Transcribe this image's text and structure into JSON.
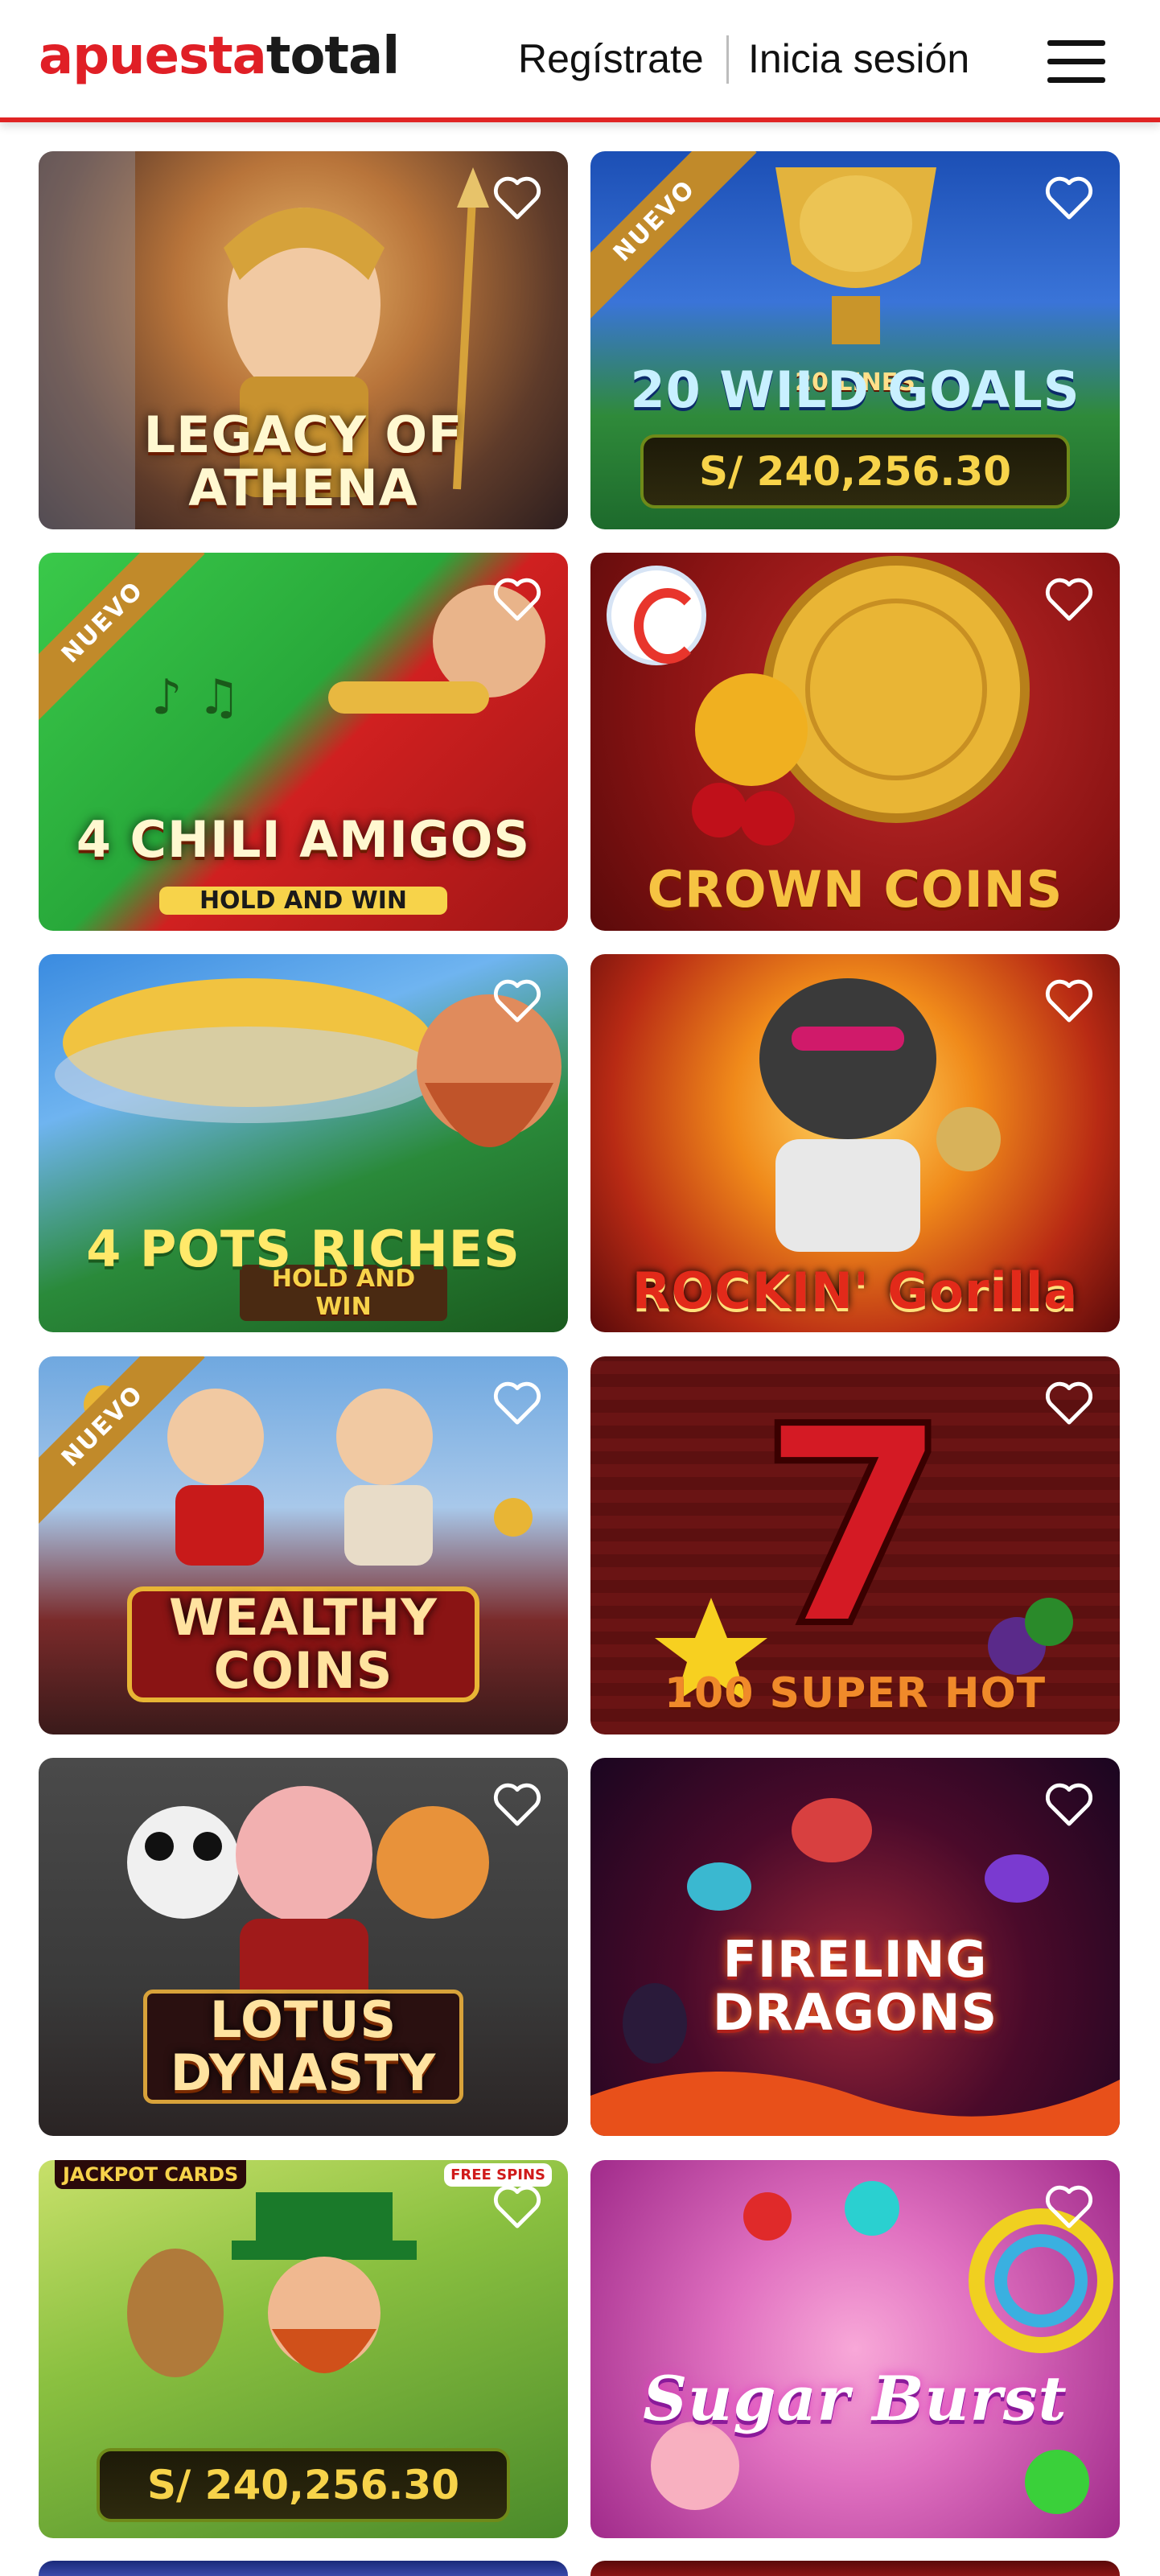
{
  "header": {
    "logo_part1": "apuesta",
    "logo_part2": "total",
    "register_label": "Regístrate",
    "login_label": "Inicia sesión",
    "menu_icon": "hamburger-icon"
  },
  "colors": {
    "brand_red": "#e01f26",
    "ribbon_gold": "#c18a2a",
    "jackpot_gold": "#f7d34a"
  },
  "ribbon_label": "NUEVO",
  "games": [
    {
      "title": "LEGACY OF ATHENA",
      "subtitle": "",
      "jackpot": "",
      "nuevo": false
    },
    {
      "title": "20 WILD GOALS",
      "subtitle": "20 LINES",
      "jackpot": "S/ 240,256.30",
      "nuevo": true
    },
    {
      "title": "4 CHILI AMIGOS",
      "subtitle": "HOLD AND WIN",
      "jackpot": "",
      "nuevo": true
    },
    {
      "title": "CROWN COINS",
      "subtitle": "",
      "jackpot": "",
      "nuevo": false
    },
    {
      "title": "4 POTS RICHES",
      "subtitle": "HOLD AND WIN",
      "jackpot": "",
      "nuevo": false
    },
    {
      "title": "ROCKIN' Gorilla",
      "subtitle": "",
      "jackpot": "",
      "nuevo": false
    },
    {
      "title": "WEALTHY COINS",
      "subtitle": "",
      "jackpot": "",
      "nuevo": true
    },
    {
      "title": "100 SUPER HOT",
      "subtitle": "",
      "jackpot": "",
      "nuevo": false
    },
    {
      "title": "LOTUS DYNASTY",
      "subtitle": "",
      "jackpot": "",
      "nuevo": false
    },
    {
      "title": "FIRELING DRAGONS",
      "subtitle": "",
      "jackpot": "",
      "nuevo": false
    },
    {
      "title": "",
      "subtitle": "",
      "jackpot": "S/ 240,256.30",
      "nuevo": false,
      "badge_left": "JACKPOT CARDS",
      "badge_right": "FREE SPINS"
    },
    {
      "title": "Sugar Burst",
      "subtitle": "",
      "jackpot": "",
      "nuevo": false
    }
  ]
}
